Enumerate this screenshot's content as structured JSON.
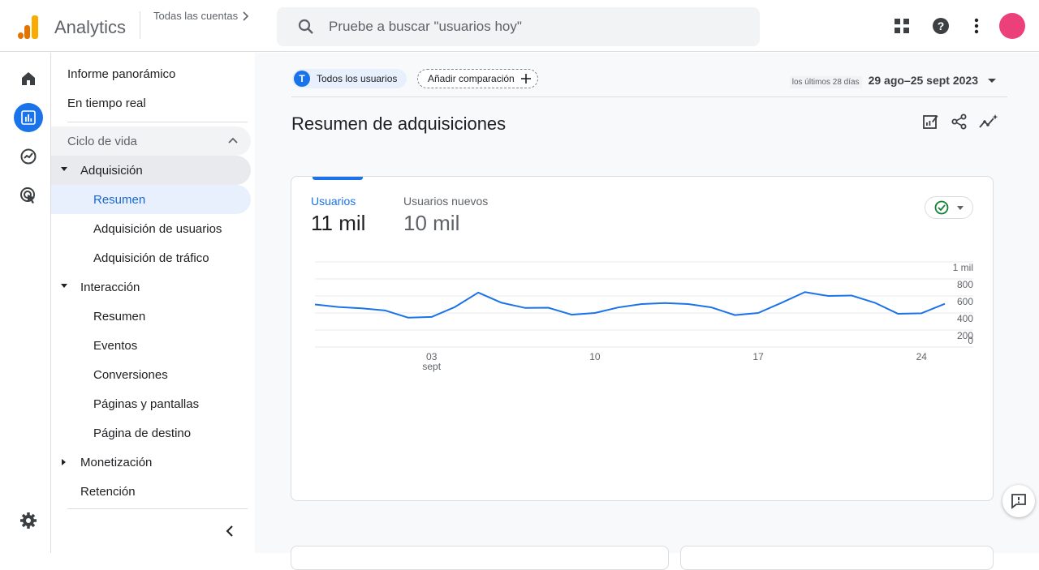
{
  "header": {
    "app_name": "Analytics",
    "accounts_label": "Todas las cuentas",
    "search_placeholder": "Pruebe a buscar \"usuarios hoy\""
  },
  "sidebar": {
    "items": [
      {
        "label": "Informe panorámico"
      },
      {
        "label": "En tiempo real"
      },
      {
        "label": "Ciclo de vida"
      },
      {
        "label": "Adquisición"
      },
      {
        "label": "Resumen"
      },
      {
        "label": "Adquisición de usuarios"
      },
      {
        "label": "Adquisición de tráfico"
      },
      {
        "label": "Interacción"
      },
      {
        "label": "Resumen"
      },
      {
        "label": "Eventos"
      },
      {
        "label": "Conversiones"
      },
      {
        "label": "Páginas y pantallas"
      },
      {
        "label": "Página de destino"
      },
      {
        "label": "Monetización"
      },
      {
        "label": "Retención"
      }
    ]
  },
  "filters": {
    "segment_badge": "T",
    "segment_label": "Todos los usuarios",
    "add_comparison": "Añadir comparación"
  },
  "daterange": {
    "prefix": "los últimos 28 días",
    "range": "29 ago–25 sept 2023"
  },
  "page": {
    "title": "Resumen de adquisiciones"
  },
  "metrics": [
    {
      "label": "Usuarios",
      "value": "11 mil"
    },
    {
      "label": "Usuarios nuevos",
      "value": "10 mil"
    }
  ],
  "colors": {
    "accent": "#1a73e8",
    "avatar": "#ec407a",
    "logo_orange": "#f9ab00",
    "logo_dark_orange": "#e37400"
  },
  "chart_data": {
    "type": "line",
    "series": [
      {
        "values": [
          500,
          470,
          455,
          430,
          345,
          353,
          470,
          640,
          520,
          460,
          462,
          380,
          400,
          465,
          505,
          517,
          505,
          465,
          375,
          400,
          520,
          645,
          600,
          605,
          520,
          390,
          397,
          508
        ]
      }
    ],
    "x_tick_labels": [
      {
        "index": 5,
        "label": "03",
        "sub": "sept"
      },
      {
        "index": 12,
        "label": "10",
        "sub": ""
      },
      {
        "index": 19,
        "label": "17",
        "sub": ""
      },
      {
        "index": 26,
        "label": "24",
        "sub": ""
      }
    ],
    "y_ticks": [
      {
        "value": 0,
        "label": "0"
      },
      {
        "value": 200,
        "label": "200"
      },
      {
        "value": 400,
        "label": "400"
      },
      {
        "value": 600,
        "label": "600"
      },
      {
        "value": 800,
        "label": "800"
      },
      {
        "value": 1000,
        "label": "1 mil"
      }
    ],
    "ylim": [
      0,
      1000
    ],
    "grid": true,
    "color": "#1a73e8"
  }
}
